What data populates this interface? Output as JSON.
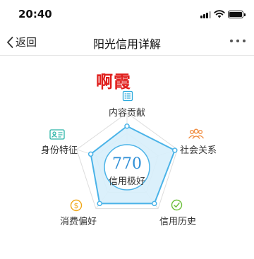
{
  "status_bar": {
    "time": "20:40"
  },
  "nav": {
    "back_label": "返回",
    "title": "阳光信用详解"
  },
  "user": {
    "name": "啊霞"
  },
  "credit": {
    "score": "770",
    "level": "信用极好"
  },
  "dimensions": [
    {
      "key": "content",
      "label": "内容贡献",
      "icon": "list-icon",
      "color": "#2aa9dc"
    },
    {
      "key": "social",
      "label": "社会关系",
      "icon": "people-icon",
      "color": "#f08a3c"
    },
    {
      "key": "history",
      "label": "信用历史",
      "icon": "check-icon",
      "color": "#6cbf3a"
    },
    {
      "key": "consumption",
      "label": "消费偏好",
      "icon": "dollar-icon",
      "color": "#f0a81a"
    },
    {
      "key": "identity",
      "label": "身份特征",
      "icon": "id-card-icon",
      "color": "#2bb5a8"
    }
  ],
  "radar_values": [
    0.75,
    0.95,
    0.88,
    0.88,
    0.72
  ],
  "colors": {
    "accent": "#4ab3e8",
    "fill": "#d7eefb",
    "name": "#e0201d"
  }
}
